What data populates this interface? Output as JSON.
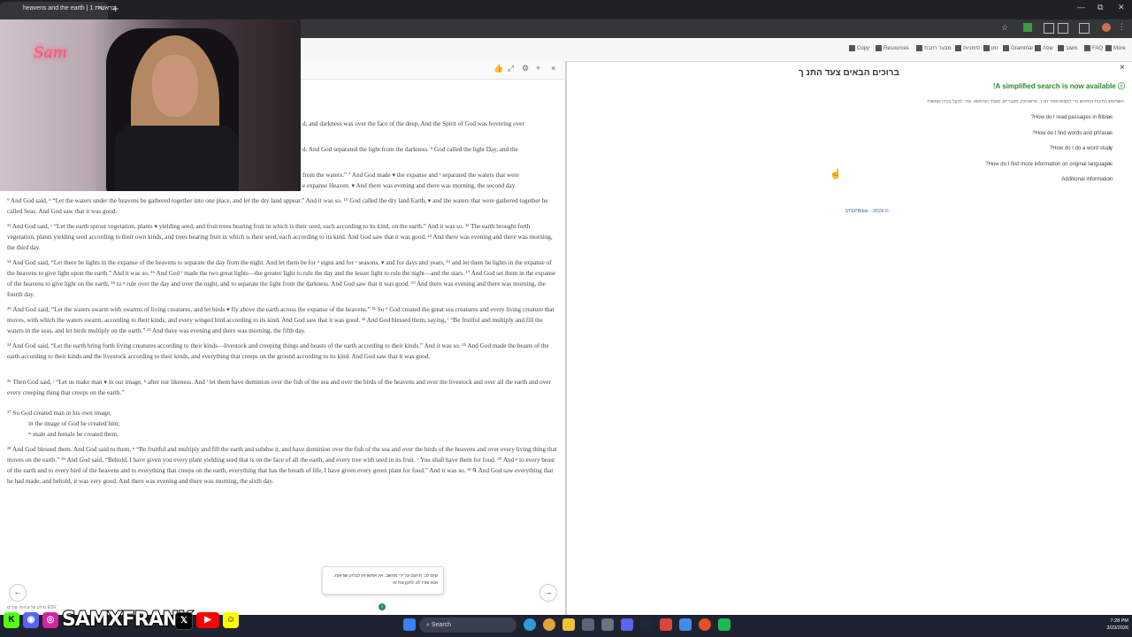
{
  "browser": {
    "tab_title": "heavens and the earth | 1 בְּרֵאשִׁית",
    "new_tab": "+",
    "tab_close": "×",
    "window_controls": [
      "—",
      "⧉",
      "✕"
    ]
  },
  "toolbar": {
    "items": [
      {
        "label": "Copy",
        "icon": "copy-icon"
      },
      {
        "label": "Resources",
        "icon": "resources-icon"
      },
      {
        "label": "מבער רחבת",
        "icon": "chart-icon"
      },
      {
        "label": "סימניות",
        "icon": "bookmark-icon"
      },
      {
        "label": "זמן",
        "icon": "font-icon"
      },
      {
        "label": "Grammar",
        "icon": "grammar-icon"
      },
      {
        "label": "שפה",
        "icon": "language-icon"
      },
      {
        "label": "משוב",
        "icon": "feedback-icon"
      },
      {
        "label": "FAQ",
        "icon": "help-icon"
      },
      {
        "label": "More",
        "icon": "more-icon"
      }
    ]
  },
  "left_panel": {
    "header_icons": [
      "thumb-up-icon",
      "expand-icon",
      "gear-icon",
      "add-icon",
      "close-icon"
    ],
    "verses_partial": [
      "d, and darkness was over the face of the deep. And the Spirit of God was hovering over",
      "d. And God separated the light from the darkness. ⁵ God called the light Day, and the",
      "from the waters.” ⁷ And God made ▾ the expanse and ᵃ separated the waters that were",
      "e expanse Heaven. ▾ And there was evening and there was morning, the second day."
    ],
    "paragraphs": [
      "⁹ And God said, ᵇ “Let the waters under the heavens be gathered together into one place, and let the dry land appear.” And it was so. ¹⁰ God called the dry land Earth, ▾ and the waters that were gathered together he called Seas. And God saw that it was good.",
      "¹¹ And God said, ᶜ “Let the earth sprout vegetation, plants ▾ yielding seed, and fruit trees bearing fruit in which is their seed, each according to its kind, on the earth.” And it was so. ¹² The earth brought forth vegetation, plants yielding seed according to their own kinds, and trees bearing fruit in which is their seed, each according to its kind. And God saw that it was good. ¹³ And there was evening and there was morning, the third day.",
      "¹⁴ And God said, “Let there be lights in the expanse of the heavens to separate the day from the night. And let them be for ᵈ signs and for ᵉ seasons, ▾ and for days and years, ¹⁵ and let them be lights in the expanse of the heavens to give light upon the earth.” And it was so. ¹⁶ And God ᶠ made the two great lights—the greater light to rule the day and the lesser light to rule the night—and the stars. ¹⁷ And God set them in the expanse of the heavens to give light on the earth, ¹⁸ to ᵍ rule over the day and over the night, and to separate the light from the darkness. And God saw that it was good. ¹⁹ And there was evening and there was morning, the fourth day.",
      "²⁰ And God said, “Let the waters swarm with swarms of living creatures, and let birds ▾ fly above the earth across the expanse of the heavens.” ²¹ So ʰ God created the great sea creatures and every living creature that moves, with which the waters swarm, according to their kinds, and every winged bird according to its kind. And God saw that it was good. ²² And God blessed them, saying, ⁱ “Be fruitful and multiply and fill the waters in the seas, and let birds multiply on the earth.” ²³ And there was evening and there was morning, the fifth day.",
      "²⁴ And God said, “Let the earth bring forth living creatures according to their kinds—livestock and creeping things and beasts of the earth according to their kinds.” And it was so. ²⁵ And God made the beasts of the earth according to their kinds and the livestock according to their kinds, and everything that creeps on the ground according to its kind. And God saw that it was good.",
      "²⁶ Then God said, ʲ “Let us make man ▾ in our image, ᵏ after our likeness. And ˡ let them have dominion over the fish of the sea and over the birds of the heavens and over the livestock and over all the earth and over every creeping thing that creeps on the earth.”"
    ],
    "poem": [
      "²⁷   So God created man in his own image,",
      "in the image of God he created him;",
      "ᵐ male and female he created them."
    ],
    "last_paragraph": "²⁸ And God blessed them. And God said to them, ⁿ “Be fruitful and multiply and fill the earth and subdue it, and have dominion over the fish of the sea and over the birds of the heavens and over every living thing that moves on the earth.” ²⁹ And God said, “Behold, I have given you every plant yielding seed that is on the face of all the earth, and every tree with seed in its fruit. ᵒ You shall have them for food. ³⁰ And ᵖ to every beast of the earth and to every bird of the heavens and to everything that creeps on the earth, everything that has the breath of life, I have given every green plant for food.” And it was so. ³¹ ᑫ And God saw everything that he had made, and behold, it was very good. And there was evening and there was morning, the sixth day.",
    "copyright": "מידע על זכויות יוצרים ESV",
    "prev": "←",
    "next": "→"
  },
  "popup": {
    "text": "שים לב: תרגום על ידי מחשב. אין אפשרות לבדוק שגיאות. אנא עזרו לנו לתקן את זה"
  },
  "right_panel": {
    "close": "×",
    "title": "ברוכים הבאים צעד התנ ך",
    "notice": "!A simplified search is now available",
    "small_text": "השתמש בתיבת החיפוש כדי למצוא ספרי תנ ך, פרשנויות, מעבריים, מונחי הודחשא. עזר: להקל בנח ראמשית.",
    "links": [
      "?How do I read passages in Bibles",
      "?How do I find words and phrases",
      "?How do I do a word study",
      "?How do I find more information on original languages",
      "Additional information"
    ],
    "footer": "STEPBible - 2024 ©"
  },
  "overlay": {
    "handle": "SAMXFRANK",
    "neon": "Sam"
  },
  "taskbar": {
    "search": "Search",
    "time": "7:28 PM",
    "date": "3/23/2026"
  }
}
